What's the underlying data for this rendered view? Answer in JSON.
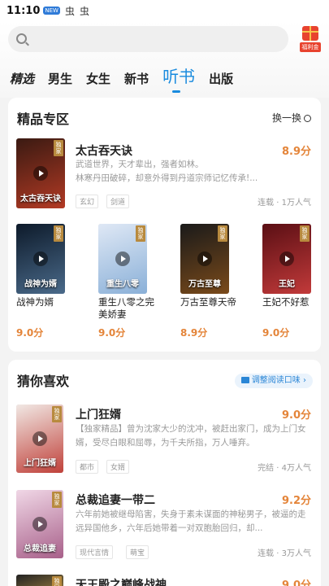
{
  "status": {
    "time": "11:10",
    "badge": "NEW",
    "icons": [
      "bug-icon",
      "bug-icon"
    ]
  },
  "search": {
    "placeholder": ""
  },
  "welfare": {
    "label": "福利金"
  },
  "tabs": [
    {
      "label": "精选"
    },
    {
      "label": "男生"
    },
    {
      "label": "女生"
    },
    {
      "label": "新书"
    },
    {
      "label": "听书"
    },
    {
      "label": "出版"
    }
  ],
  "premium": {
    "title": "精品专区",
    "swap_label": "换一换",
    "tag": "独家",
    "featured": {
      "title": "太古吞天诀",
      "score": "8.9分",
      "desc1": "武道世界，天才辈出，强者如林。",
      "desc2": "林寒丹田破碎，却意外得到丹道宗师记忆传承!...",
      "tags": [
        "玄幻",
        "剑道"
      ],
      "meta": "连载 · 1万人气",
      "cover_text": "太古吞天诀",
      "colors": [
        "#3a1a12",
        "#b33a24"
      ]
    },
    "grid": [
      {
        "title": "战神为婿",
        "score": "9.0分",
        "cover_text": "战神为婿",
        "colors": [
          "#0d1a2a",
          "#4a6a8a"
        ]
      },
      {
        "title": "重生八零之完美娇妻",
        "score": "9.0分",
        "cover_text": "重生八零",
        "colors": [
          "#dfe8f5",
          "#8ab0d8"
        ]
      },
      {
        "title": "万古至尊天帝",
        "score": "8.9分",
        "cover_text": "万古至尊",
        "colors": [
          "#1a1a1a",
          "#7a4a1a"
        ]
      },
      {
        "title": "王妃不好惹",
        "score": "9.0分",
        "cover_text": "王妃",
        "colors": [
          "#5a0f14",
          "#c23a3a"
        ]
      }
    ]
  },
  "guess": {
    "title": "猜你喜欢",
    "adjust_label": "调整阅读口味 ›",
    "tag": "独家",
    "items": [
      {
        "title": "上门狂婿",
        "score": "9.0分",
        "desc": "【独家精品】曾为沈家大少的沈冲，被赶出家门，成为上门女婿，受尽白眼和屈辱，为千夫所指，万人唾弃。",
        "tags": [
          "都市",
          "女婿"
        ],
        "meta": "完结 · 4万人气",
        "cover_text": "上门狂婿",
        "colors": [
          "#f1e8e4",
          "#c0413a"
        ]
      },
      {
        "title": "总裁追妻一带二",
        "score": "9.2分",
        "desc": "六年前她被继母陷害，失身于素未谋面的神秘男子，被逼的走远异国他乡，六年后她带着一对双胞胎回归，却...",
        "tags": [
          "现代言情",
          "萌宝"
        ],
        "meta": "连载 · 3万人气",
        "cover_text": "总裁追妻",
        "colors": [
          "#f0d7e6",
          "#a8608a"
        ]
      },
      {
        "title": "天王殿之巅峰战神",
        "score": "9.0分",
        "desc": "",
        "tags": [],
        "meta": "",
        "cover_text": "",
        "colors": [
          "#222",
          "#c9a04a"
        ]
      }
    ]
  }
}
